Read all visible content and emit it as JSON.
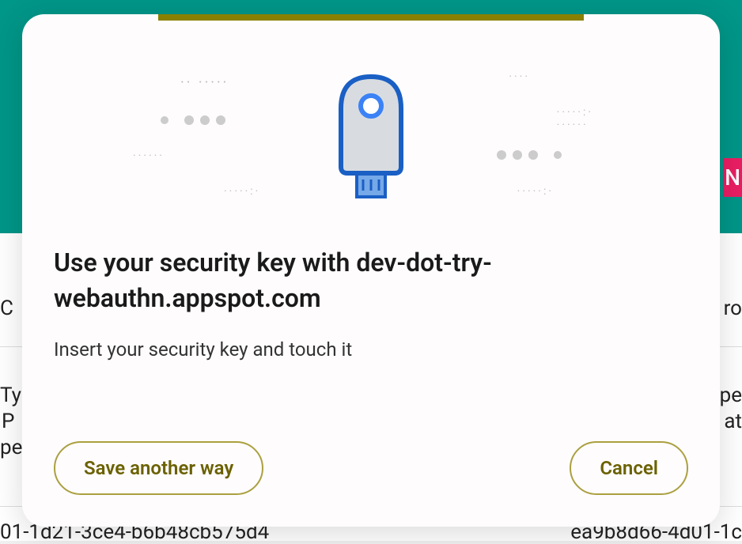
{
  "background": {
    "left_text_1": "C",
    "right_text_1": "ro",
    "left_text_2a": "Ty",
    "left_text_2b": "P",
    "left_text_2c": "pe",
    "right_text_2a": "pe",
    "right_text_2b": "at",
    "left_text_3": "01-1d21-3ce4-b6b48cb575d4",
    "right_text_3": "ea9b8d66-4d01-1c",
    "new_badge": "N"
  },
  "modal": {
    "title": "Use your security key with dev-dot-try-webauthn.appspot.com",
    "subtitle": "Insert your security key and touch it",
    "save_another_way": "Save another way",
    "cancel": "Cancel"
  },
  "colors": {
    "teal": "#009688",
    "olive": "#8a8000",
    "olive_border": "#aba040",
    "olive_text": "#6b6100",
    "blue": "#1a73e8",
    "light_blue": "#4285f4",
    "grey": "#c0c0c0"
  }
}
